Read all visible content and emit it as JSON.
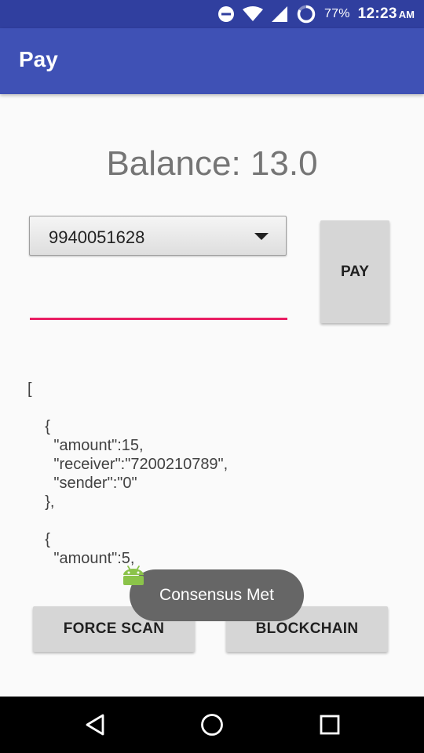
{
  "status_bar": {
    "battery": "77%",
    "time": "12:23",
    "ampm": "AM",
    "icons": [
      "do-not-disturb-icon",
      "wifi-icon",
      "signal-icon",
      "battery-icon"
    ]
  },
  "app_bar": {
    "title": "Pay"
  },
  "balance_text": "Balance: 13.0",
  "recipient_spinner": {
    "selected": "9940051628",
    "icon": "dropdown-arrow-icon"
  },
  "amount_input": {
    "value": "",
    "placeholder": ""
  },
  "pay_button": {
    "label": "PAY"
  },
  "blockchain_text": {
    "lines": [
      "[",
      "",
      "    {",
      "      \"amount\":15,",
      "      \"receiver\":\"7200210789\",",
      "      \"sender\":\"0\"",
      "    },",
      "",
      "    {",
      "      \"amount\":5,"
    ]
  },
  "buttons": {
    "force_scan": "FORCE SCAN",
    "blockchain": "BLOCKCHAIN"
  },
  "toast": {
    "message": "Consensus Met",
    "icon": "android-icon"
  },
  "nav_bar": {
    "icons": [
      "back-icon",
      "home-icon",
      "recents-icon"
    ]
  },
  "colors": {
    "primary": "#3f51b5",
    "primary_dark": "#303f9f",
    "accent": "#e91e63",
    "android_green": "#8bc34a"
  }
}
